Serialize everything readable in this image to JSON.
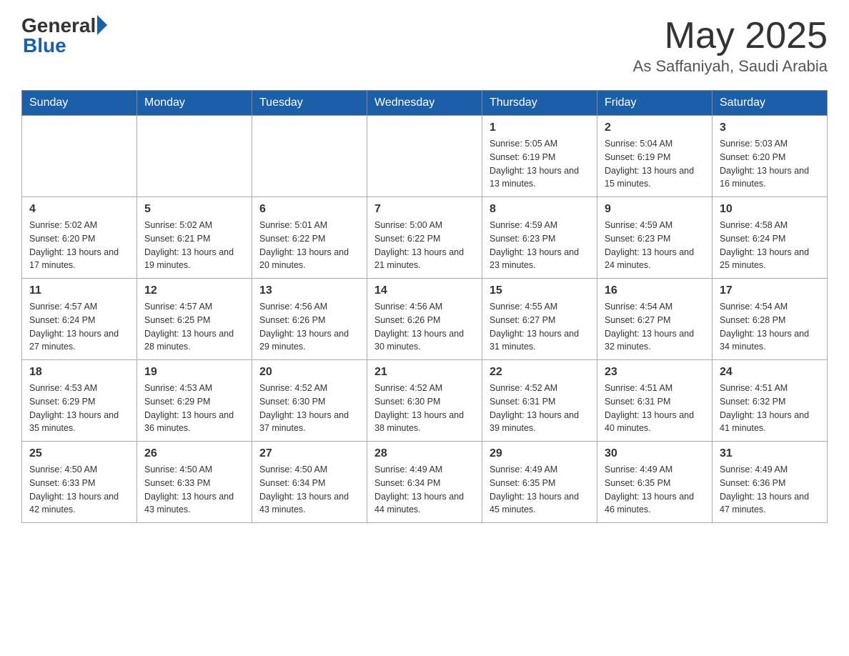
{
  "header": {
    "logo": {
      "general": "General",
      "blue": "Blue"
    },
    "title": "May 2025",
    "location": "As Saffaniyah, Saudi Arabia"
  },
  "days_of_week": [
    "Sunday",
    "Monday",
    "Tuesday",
    "Wednesday",
    "Thursday",
    "Friday",
    "Saturday"
  ],
  "weeks": [
    [
      {
        "day": "",
        "sunrise": "",
        "sunset": "",
        "daylight": ""
      },
      {
        "day": "",
        "sunrise": "",
        "sunset": "",
        "daylight": ""
      },
      {
        "day": "",
        "sunrise": "",
        "sunset": "",
        "daylight": ""
      },
      {
        "day": "",
        "sunrise": "",
        "sunset": "",
        "daylight": ""
      },
      {
        "day": "1",
        "sunrise": "Sunrise: 5:05 AM",
        "sunset": "Sunset: 6:19 PM",
        "daylight": "Daylight: 13 hours and 13 minutes."
      },
      {
        "day": "2",
        "sunrise": "Sunrise: 5:04 AM",
        "sunset": "Sunset: 6:19 PM",
        "daylight": "Daylight: 13 hours and 15 minutes."
      },
      {
        "day": "3",
        "sunrise": "Sunrise: 5:03 AM",
        "sunset": "Sunset: 6:20 PM",
        "daylight": "Daylight: 13 hours and 16 minutes."
      }
    ],
    [
      {
        "day": "4",
        "sunrise": "Sunrise: 5:02 AM",
        "sunset": "Sunset: 6:20 PM",
        "daylight": "Daylight: 13 hours and 17 minutes."
      },
      {
        "day": "5",
        "sunrise": "Sunrise: 5:02 AM",
        "sunset": "Sunset: 6:21 PM",
        "daylight": "Daylight: 13 hours and 19 minutes."
      },
      {
        "day": "6",
        "sunrise": "Sunrise: 5:01 AM",
        "sunset": "Sunset: 6:22 PM",
        "daylight": "Daylight: 13 hours and 20 minutes."
      },
      {
        "day": "7",
        "sunrise": "Sunrise: 5:00 AM",
        "sunset": "Sunset: 6:22 PM",
        "daylight": "Daylight: 13 hours and 21 minutes."
      },
      {
        "day": "8",
        "sunrise": "Sunrise: 4:59 AM",
        "sunset": "Sunset: 6:23 PM",
        "daylight": "Daylight: 13 hours and 23 minutes."
      },
      {
        "day": "9",
        "sunrise": "Sunrise: 4:59 AM",
        "sunset": "Sunset: 6:23 PM",
        "daylight": "Daylight: 13 hours and 24 minutes."
      },
      {
        "day": "10",
        "sunrise": "Sunrise: 4:58 AM",
        "sunset": "Sunset: 6:24 PM",
        "daylight": "Daylight: 13 hours and 25 minutes."
      }
    ],
    [
      {
        "day": "11",
        "sunrise": "Sunrise: 4:57 AM",
        "sunset": "Sunset: 6:24 PM",
        "daylight": "Daylight: 13 hours and 27 minutes."
      },
      {
        "day": "12",
        "sunrise": "Sunrise: 4:57 AM",
        "sunset": "Sunset: 6:25 PM",
        "daylight": "Daylight: 13 hours and 28 minutes."
      },
      {
        "day": "13",
        "sunrise": "Sunrise: 4:56 AM",
        "sunset": "Sunset: 6:26 PM",
        "daylight": "Daylight: 13 hours and 29 minutes."
      },
      {
        "day": "14",
        "sunrise": "Sunrise: 4:56 AM",
        "sunset": "Sunset: 6:26 PM",
        "daylight": "Daylight: 13 hours and 30 minutes."
      },
      {
        "day": "15",
        "sunrise": "Sunrise: 4:55 AM",
        "sunset": "Sunset: 6:27 PM",
        "daylight": "Daylight: 13 hours and 31 minutes."
      },
      {
        "day": "16",
        "sunrise": "Sunrise: 4:54 AM",
        "sunset": "Sunset: 6:27 PM",
        "daylight": "Daylight: 13 hours and 32 minutes."
      },
      {
        "day": "17",
        "sunrise": "Sunrise: 4:54 AM",
        "sunset": "Sunset: 6:28 PM",
        "daylight": "Daylight: 13 hours and 34 minutes."
      }
    ],
    [
      {
        "day": "18",
        "sunrise": "Sunrise: 4:53 AM",
        "sunset": "Sunset: 6:29 PM",
        "daylight": "Daylight: 13 hours and 35 minutes."
      },
      {
        "day": "19",
        "sunrise": "Sunrise: 4:53 AM",
        "sunset": "Sunset: 6:29 PM",
        "daylight": "Daylight: 13 hours and 36 minutes."
      },
      {
        "day": "20",
        "sunrise": "Sunrise: 4:52 AM",
        "sunset": "Sunset: 6:30 PM",
        "daylight": "Daylight: 13 hours and 37 minutes."
      },
      {
        "day": "21",
        "sunrise": "Sunrise: 4:52 AM",
        "sunset": "Sunset: 6:30 PM",
        "daylight": "Daylight: 13 hours and 38 minutes."
      },
      {
        "day": "22",
        "sunrise": "Sunrise: 4:52 AM",
        "sunset": "Sunset: 6:31 PM",
        "daylight": "Daylight: 13 hours and 39 minutes."
      },
      {
        "day": "23",
        "sunrise": "Sunrise: 4:51 AM",
        "sunset": "Sunset: 6:31 PM",
        "daylight": "Daylight: 13 hours and 40 minutes."
      },
      {
        "day": "24",
        "sunrise": "Sunrise: 4:51 AM",
        "sunset": "Sunset: 6:32 PM",
        "daylight": "Daylight: 13 hours and 41 minutes."
      }
    ],
    [
      {
        "day": "25",
        "sunrise": "Sunrise: 4:50 AM",
        "sunset": "Sunset: 6:33 PM",
        "daylight": "Daylight: 13 hours and 42 minutes."
      },
      {
        "day": "26",
        "sunrise": "Sunrise: 4:50 AM",
        "sunset": "Sunset: 6:33 PM",
        "daylight": "Daylight: 13 hours and 43 minutes."
      },
      {
        "day": "27",
        "sunrise": "Sunrise: 4:50 AM",
        "sunset": "Sunset: 6:34 PM",
        "daylight": "Daylight: 13 hours and 43 minutes."
      },
      {
        "day": "28",
        "sunrise": "Sunrise: 4:49 AM",
        "sunset": "Sunset: 6:34 PM",
        "daylight": "Daylight: 13 hours and 44 minutes."
      },
      {
        "day": "29",
        "sunrise": "Sunrise: 4:49 AM",
        "sunset": "Sunset: 6:35 PM",
        "daylight": "Daylight: 13 hours and 45 minutes."
      },
      {
        "day": "30",
        "sunrise": "Sunrise: 4:49 AM",
        "sunset": "Sunset: 6:35 PM",
        "daylight": "Daylight: 13 hours and 46 minutes."
      },
      {
        "day": "31",
        "sunrise": "Sunrise: 4:49 AM",
        "sunset": "Sunset: 6:36 PM",
        "daylight": "Daylight: 13 hours and 47 minutes."
      }
    ]
  ]
}
